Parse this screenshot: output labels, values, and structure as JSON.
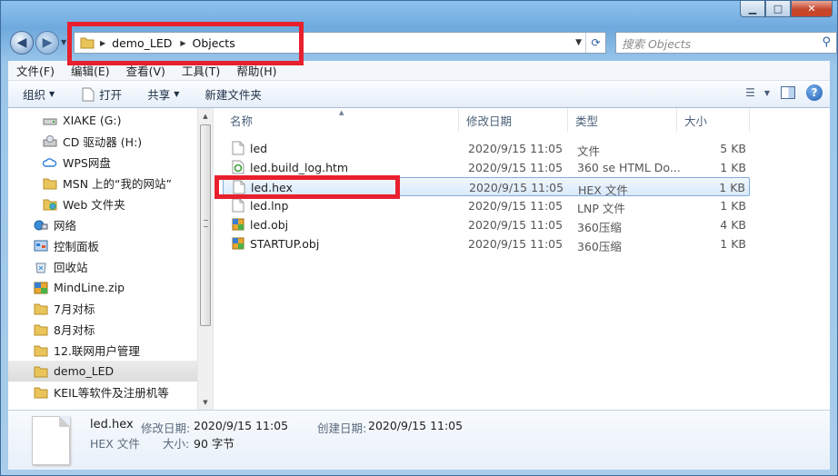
{
  "window": {
    "min_glyph": "▁",
    "max_glyph": "□",
    "close_glyph": "✕"
  },
  "address": {
    "crumbs": [
      "demo_LED",
      "Objects"
    ]
  },
  "search": {
    "placeholder": "搜索 Objects"
  },
  "menu": [
    "文件(F)",
    "编辑(E)",
    "查看(V)",
    "工具(T)",
    "帮助(H)"
  ],
  "toolbar": {
    "organize": "组织",
    "open": "打开",
    "share": "共享",
    "new_folder": "新建文件夹"
  },
  "nav_items": [
    {
      "label": "XIAKE (G:)",
      "icon": "drive-icon"
    },
    {
      "label": "CD 驱动器 (H:)",
      "icon": "cd-drive-icon"
    },
    {
      "label": "WPS网盘",
      "icon": "cloud-icon"
    },
    {
      "label": "MSN 上的“我的网站”",
      "icon": "folder-icon"
    },
    {
      "label": "Web 文件夹",
      "icon": "web-folder-icon"
    },
    {
      "label": "网络",
      "icon": "network-icon"
    },
    {
      "label": "控制面板",
      "icon": "control-panel-icon"
    },
    {
      "label": "回收站",
      "icon": "recycle-bin-icon"
    },
    {
      "label": "MindLine.zip",
      "icon": "zip-icon"
    },
    {
      "label": "7月对标",
      "icon": "folder-icon"
    },
    {
      "label": "8月对标",
      "icon": "folder-icon"
    },
    {
      "label": "12.联网用户管理",
      "icon": "folder-icon"
    },
    {
      "label": "demo_LED",
      "icon": "folder-icon",
      "selected": true
    },
    {
      "label": "KEIL等软件及注册机等",
      "icon": "folder-icon"
    }
  ],
  "columns": {
    "name": "名称",
    "modified": "修改日期",
    "type": "类型",
    "size": "大小"
  },
  "files": [
    {
      "name": "led",
      "modified": "2020/9/15 11:05",
      "type": "文件",
      "size": "5 KB",
      "icon": "file-icon"
    },
    {
      "name": "led.build_log.htm",
      "modified": "2020/9/15 11:05",
      "type": "360 se HTML Do...",
      "size": "1 KB",
      "icon": "html-file-icon"
    },
    {
      "name": "led.hex",
      "modified": "2020/9/15 11:05",
      "type": "HEX 文件",
      "size": "1 KB",
      "icon": "file-icon",
      "selected": true
    },
    {
      "name": "led.lnp",
      "modified": "2020/9/15 11:05",
      "type": "LNP 文件",
      "size": "1 KB",
      "icon": "file-icon"
    },
    {
      "name": "led.obj",
      "modified": "2020/9/15 11:05",
      "type": "360压缩",
      "size": "4 KB",
      "icon": "zip-icon"
    },
    {
      "name": "STARTUP.obj",
      "modified": "2020/9/15 11:05",
      "type": "360压缩",
      "size": "1 KB",
      "icon": "zip-icon"
    }
  ],
  "details": {
    "name": "led.hex",
    "type": "HEX 文件",
    "modified_label": "修改日期:",
    "modified": "2020/9/15 11:05",
    "created_label": "创建日期:",
    "created": "2020/9/15 11:05",
    "size_label": "大小:",
    "size": "90 字节"
  },
  "colors": {
    "highlight_box": "#e8202e",
    "selection": "#d9e9fb"
  }
}
